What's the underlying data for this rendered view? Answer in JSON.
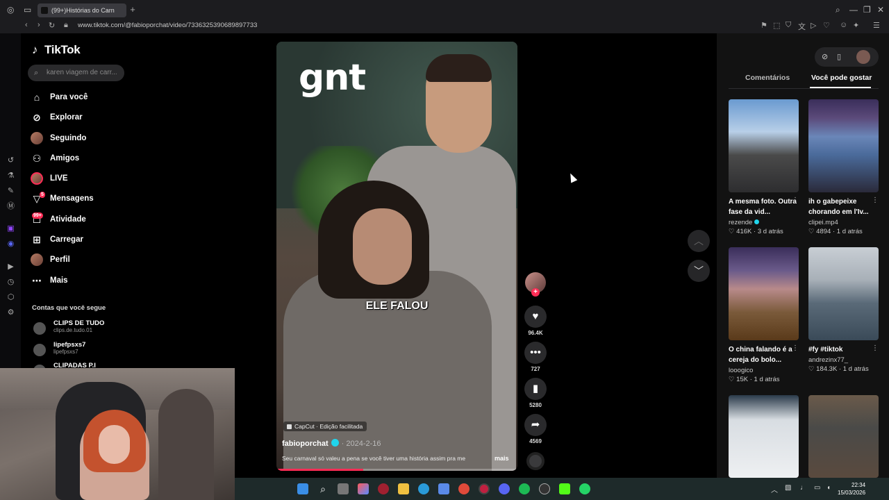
{
  "browser": {
    "tab_title": "(99+)Histórias do Carn",
    "url": "www.tiktok.com/@fabioporchat/video/7336325390689897733"
  },
  "tiktok": {
    "logo": "TikTok",
    "search_placeholder": "karen viagem de carr...",
    "nav": [
      {
        "label": "Para você",
        "icon": "home-icon"
      },
      {
        "label": "Explorar",
        "icon": "compass-icon"
      },
      {
        "label": "Seguindo",
        "icon": "following-avatar"
      },
      {
        "label": "Amigos",
        "icon": "friends-icon"
      },
      {
        "label": "LIVE",
        "icon": "live-avatar"
      },
      {
        "label": "Mensagens",
        "icon": "messages-icon",
        "badge": "5"
      },
      {
        "label": "Atividade",
        "icon": "activity-icon",
        "badge": "99+"
      },
      {
        "label": "Carregar",
        "icon": "upload-icon"
      },
      {
        "label": "Perfil",
        "icon": "profile-avatar"
      },
      {
        "label": "Mais",
        "icon": "more-icon"
      }
    ],
    "following_title": "Contas que você segue",
    "following": [
      {
        "name": "CLIPS DE TUDO",
        "handle": "clips.de.tudo.01"
      },
      {
        "name": "lipefpsxs7",
        "handle": "lipefpsxs7"
      },
      {
        "name": "CLIPADAS P.I",
        "handle": ""
      }
    ]
  },
  "video": {
    "watermark": "gnt",
    "caption_overlay": "ELE FALOU",
    "capcut": "CapCut · Edição facilitada",
    "author": "fabioporchat",
    "date": "· 2024-2-16",
    "description": "Seu carnaval só valeu a pena se você tiver uma história assim pra me",
    "more": "mais",
    "progress": 0.36
  },
  "actions": {
    "likes": "96.4K",
    "comments": "727",
    "saves": "5280",
    "shares": "4569"
  },
  "right_panel": {
    "tabs": [
      "Comentários",
      "Você pode gostar"
    ],
    "active_tab": 1,
    "cards": [
      {
        "title": "A mesma foto. Outra fase da vid...",
        "author": "rezende",
        "verified": true,
        "likes": "416K",
        "age": "3 d atrás"
      },
      {
        "title": "ih o gabepeixe chorando em l'Iv...",
        "author": "clipei.mp4",
        "verified": false,
        "likes": "4894",
        "age": "1 d atrás"
      },
      {
        "title": "O china falando é a cereja do bolo...",
        "author": "looogico",
        "verified": false,
        "likes": "15K",
        "age": "1 d atrás"
      },
      {
        "title": "#fy #tiktok",
        "author": "andrezinx77_",
        "verified": false,
        "likes": "184.3K",
        "age": "1 d atrás"
      }
    ]
  },
  "taskbar": {
    "time": "22:34",
    "date": "15/03/2026"
  },
  "colors": {
    "accent": "#fe2c55",
    "verified": "#20d5ec",
    "background": "#000000"
  }
}
